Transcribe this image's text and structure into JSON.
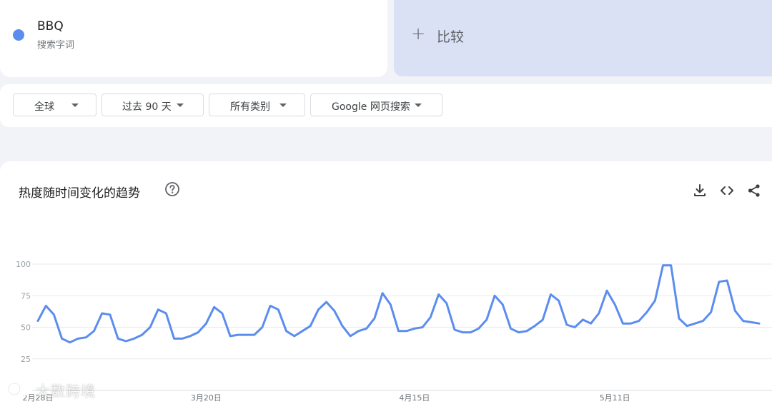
{
  "search_term": {
    "name": "BBQ",
    "type": "搜索字词",
    "color": "#5b8def"
  },
  "compare": {
    "label": "比较",
    "icon": "plus-icon"
  },
  "filters": [
    {
      "label": "全球"
    },
    {
      "label": "过去 90 天"
    },
    {
      "label": "所有类别"
    },
    {
      "label": "Google 网页搜索"
    }
  ],
  "chart_card": {
    "title": "热度随时间变化的趋势",
    "icons": [
      "help-icon",
      "download-icon",
      "embed-icon",
      "share-icon"
    ]
  },
  "watermark": {
    "text": "大数跨境"
  },
  "chart_data": {
    "type": "line",
    "title": "",
    "xlabel": "",
    "ylabel": "",
    "ylim": [
      0,
      100
    ],
    "yticks": [
      25,
      50,
      75,
      100
    ],
    "x_tick_labels": [
      "2月28日",
      "3月20日",
      "4月15日",
      "5月11日"
    ],
    "x_tick_indices": [
      0,
      21,
      47,
      72
    ],
    "grid": true,
    "series": [
      {
        "color": "#5b8def",
        "values": [
          55,
          67,
          60,
          41,
          38,
          41,
          42,
          47,
          61,
          60,
          41,
          39,
          41,
          44,
          50,
          64,
          61,
          41,
          41,
          43,
          46,
          53,
          66,
          61,
          43,
          44,
          44,
          44,
          50,
          67,
          64,
          47,
          43,
          47,
          51,
          64,
          70,
          63,
          51,
          43,
          47,
          49,
          57,
          77,
          68,
          47,
          47,
          49,
          50,
          58,
          76,
          69,
          48,
          46,
          46,
          49,
          56,
          75,
          68,
          49,
          46,
          47,
          51,
          56,
          76,
          71,
          52,
          50,
          56,
          53,
          61,
          79,
          68,
          53,
          53,
          55,
          62,
          71,
          99,
          99,
          57,
          51,
          53,
          55,
          62,
          86,
          87,
          63,
          55,
          54,
          53
        ]
      }
    ]
  }
}
